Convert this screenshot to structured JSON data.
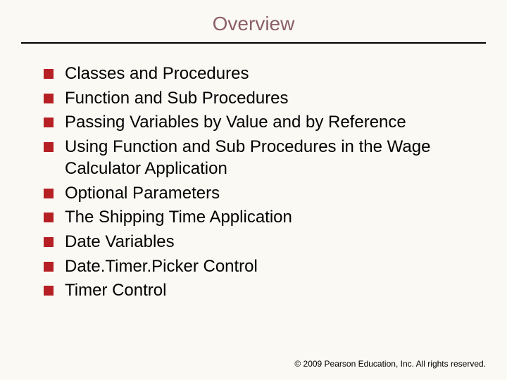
{
  "title": "Overview",
  "items": [
    "Classes and Procedures",
    "Function and Sub Procedures",
    "Passing Variables by Value and by Reference",
    "Using Function and Sub Procedures in the Wage Calculator Application",
    "Optional Parameters",
    "The Shipping Time Application",
    "Date Variables",
    "Date.Timer.Picker Control",
    "Timer Control"
  ],
  "footer": "2009 Pearson Education, Inc.  All rights reserved."
}
